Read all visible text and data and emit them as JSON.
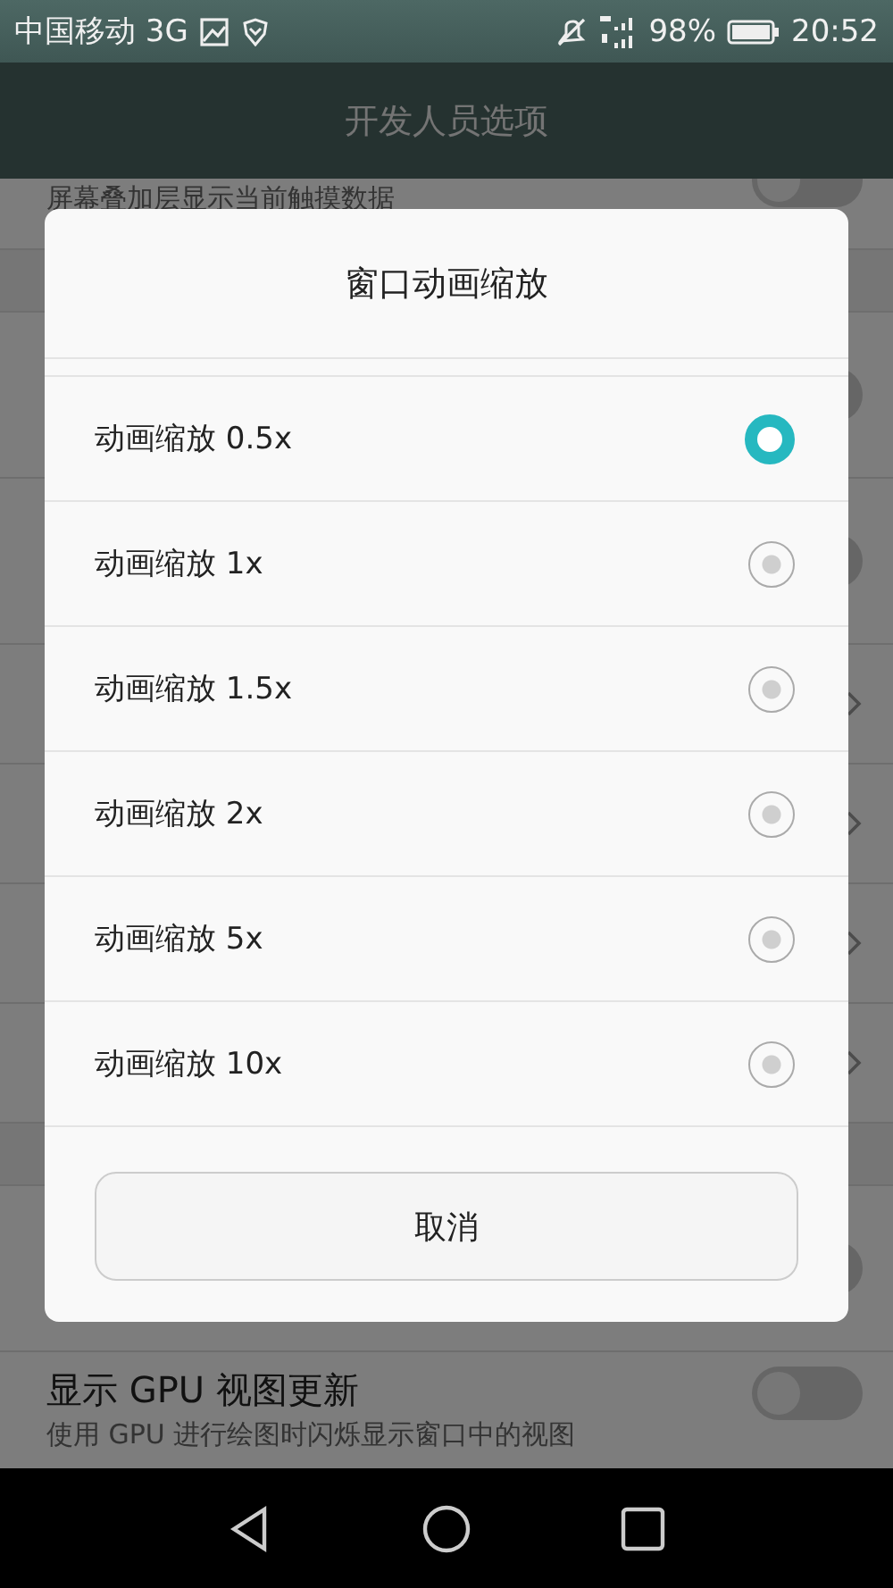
{
  "status_bar": {
    "carrier": "中国移动 3G",
    "battery": "98%",
    "time": "20:52"
  },
  "app_bar": {
    "title": "开发人员选项"
  },
  "settings": [
    {
      "kind": "switch",
      "subtitle": "屏幕叠加层显示当前触摸数据",
      "on": false
    },
    {
      "kind": "gap"
    },
    {
      "kind": "switch",
      "on": false
    },
    {
      "kind": "switch",
      "on": false
    },
    {
      "kind": "link"
    },
    {
      "kind": "link"
    },
    {
      "kind": "link"
    },
    {
      "kind": "link"
    },
    {
      "kind": "gap"
    },
    {
      "kind": "switch",
      "on": false
    },
    {
      "kind": "switch",
      "title": "显示 GPU 视图更新",
      "subtitle": "使用 GPU 进行绘图时闪烁显示窗口中的视图",
      "on": false
    }
  ],
  "dialog": {
    "title": "窗口动画缩放",
    "options": [
      {
        "label": "动画缩放 0.5x",
        "selected": true
      },
      {
        "label": "动画缩放 1x",
        "selected": false
      },
      {
        "label": "动画缩放 1.5x",
        "selected": false
      },
      {
        "label": "动画缩放 2x",
        "selected": false
      },
      {
        "label": "动画缩放 5x",
        "selected": false
      },
      {
        "label": "动画缩放 10x",
        "selected": false
      }
    ],
    "cancel": "取消"
  }
}
